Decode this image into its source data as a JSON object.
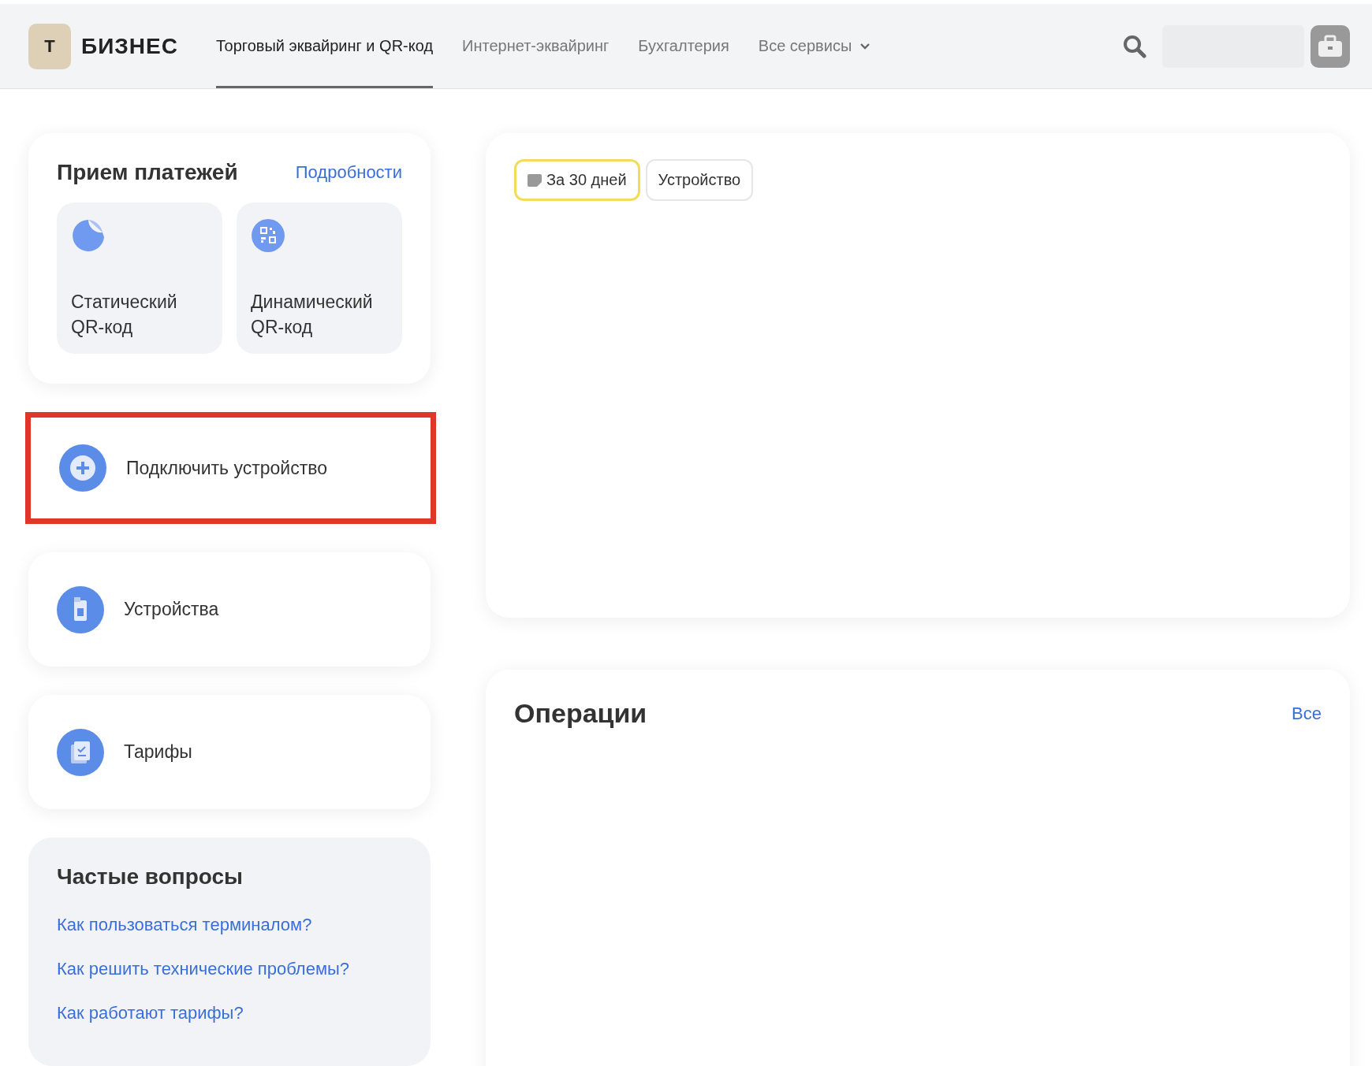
{
  "header": {
    "logo_letter": "Т",
    "brand": "БИЗНЕС",
    "tabs": [
      {
        "label": "Торговый эквайринг и QR-код",
        "selected": true
      },
      {
        "label": "Интернет-эквайринг",
        "selected": false
      },
      {
        "label": "Бухгалтерия",
        "selected": false
      },
      {
        "label": "Все сервисы",
        "selected": false,
        "kind": "dropdown"
      }
    ]
  },
  "payments": {
    "title": "Прием платежей",
    "link": "Подробности",
    "tiles": [
      {
        "kind": "sticker",
        "label": "Статический QR-код"
      },
      {
        "kind": "qr",
        "label": "Динамический QR-код"
      }
    ]
  },
  "actions": [
    {
      "kind": "plus",
      "label": "Подключить устройство",
      "highlighted": true
    },
    {
      "kind": "device",
      "label": "Устройства",
      "highlighted": false
    },
    {
      "kind": "tariff",
      "label": "Тарифы",
      "highlighted": false
    }
  ],
  "faq": {
    "title": "Частые вопросы",
    "links": [
      "Как пользоваться терминалом?",
      "Как решить технические проблемы?",
      "Как работают тарифы?"
    ]
  },
  "filters": [
    {
      "label": "За 30 дней",
      "selected": true,
      "kind": "calendar"
    },
    {
      "label": "Устройство",
      "selected": false
    }
  ],
  "operations": {
    "title": "Операции",
    "link": "Все"
  }
}
